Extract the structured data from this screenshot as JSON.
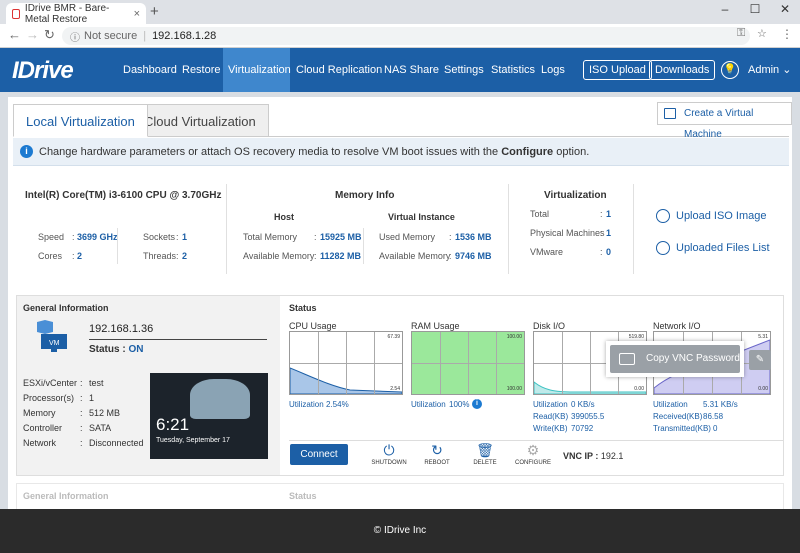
{
  "browser": {
    "tab_title": "IDrive BMR - Bare-Metal Restore",
    "not_secure": "Not secure",
    "url": "192.168.1.28"
  },
  "nav": {
    "logo": "IDrive",
    "items": [
      "Dashboard",
      "Restore",
      "Virtualization",
      "Cloud Replication",
      "NAS Share",
      "Settings",
      "Statistics",
      "Logs"
    ],
    "active": "Virtualization",
    "iso_upload": "ISO Upload",
    "downloads": "Downloads",
    "admin": "Admin"
  },
  "tabs": {
    "local": "Local Virtualization",
    "cloud": "Cloud Virtualization",
    "create_vm": "Create a Virtual Machine"
  },
  "info_banner": {
    "text": "Change hardware parameters or attach OS recovery media to resolve VM boot issues with the ",
    "bold": "Configure",
    "suffix": " option."
  },
  "system": {
    "cpu": "Intel(R) Core(TM) i3-6100 CPU @ 3.70GHz",
    "speed_label": "Speed",
    "speed": "3699 GHz",
    "sockets_label": "Sockets",
    "sockets": "1",
    "cores_label": "Cores",
    "cores": "2",
    "threads_label": "Threads",
    "threads": "2"
  },
  "memory": {
    "title": "Memory Info",
    "host_title": "Host",
    "vi_title": "Virtual Instance",
    "total_label": "Total Memory",
    "total": "15925 MB",
    "avail_label": "Available Memory",
    "avail": "11282 MB",
    "used_label": "Used Memory",
    "used": "1536 MB",
    "vi_avail_label": "Available Memory",
    "vi_avail": "9746 MB"
  },
  "virtualization": {
    "title": "Virtualization",
    "total_label": "Total",
    "total": "1",
    "physical_label": "Physical Machines",
    "physical": "1",
    "vmware_label": "VMware",
    "vmware": "0"
  },
  "links": {
    "upload_iso": "Upload ISO Image",
    "uploaded_files": "Uploaded Files List"
  },
  "general": {
    "title": "General Information",
    "ip": "192.168.1.36",
    "status_label": "Status :",
    "status": "ON",
    "esxi_label": "ESXi/vCenter",
    "esxi": "test",
    "proc_label": "Processor(s)",
    "proc": "1",
    "mem_label": "Memory",
    "mem": "512 MB",
    "ctrl_label": "Controller",
    "ctrl": "SATA",
    "net_label": "Network",
    "net": "Disconnected",
    "screen_time": "6:21",
    "screen_date": "Tuesday, September 17",
    "vm_badge": "VM"
  },
  "status": {
    "title": "Status",
    "cpu_title": "CPU Usage",
    "cpu_top": "67.39",
    "cpu_bot": "2.54",
    "cpu_util_label": "Utilization",
    "cpu_util": "2.54%",
    "ram_title": "RAM Usage",
    "ram_top": "100.00",
    "ram_bot": "100.00",
    "ram_util_label": "Utilization",
    "ram_util": "100%",
    "disk_title": "Disk I/O",
    "disk_top": "519.80",
    "disk_bot": "0.00",
    "disk_util_label": "Utilization",
    "disk_util": "0 KB/s",
    "disk_read_label": "Read(KB)",
    "disk_read": "399055.5",
    "disk_write_label": "Write(KB)",
    "disk_write": "70792",
    "net_title": "Network I/O",
    "net_top": "5.31",
    "net_bot": "0.00",
    "net_util_label": "Utilization",
    "net_util": "5.31 KB/s",
    "net_recv_label": "Received(KB)",
    "net_recv": "86.58",
    "net_trans_label": "Transmitted(KB)",
    "net_trans": "0"
  },
  "actions": {
    "connect": "Connect",
    "shutdown": "SHUTDOWN",
    "reboot": "REBOOT",
    "delete": "DELETE",
    "configure": "CONFIGURE",
    "vnc_label": "VNC IP :",
    "vnc_ip": "192.1",
    "copy_vnc": "Copy VNC Password"
  },
  "second_card": {
    "general": "General Information",
    "status": "Status"
  },
  "footer": "© IDrive Inc",
  "colors": {
    "brand": "#1c5fa6",
    "active_nav": "#3f87cd",
    "ram_fill": "#9be89b"
  }
}
